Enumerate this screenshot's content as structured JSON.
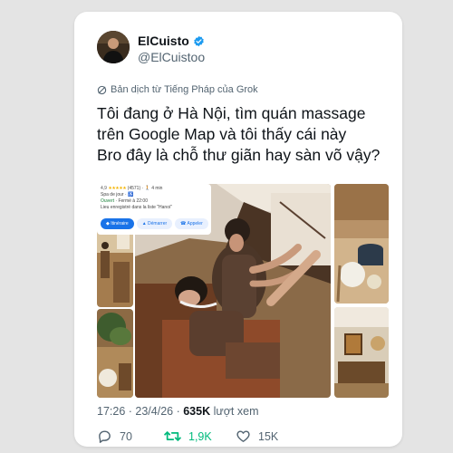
{
  "author": {
    "display_name": "ElCuisto",
    "handle": "@ElCuistoo",
    "verified": true
  },
  "translation_label": "Bản dịch từ Tiếng Pháp của Grok",
  "tweet": {
    "lines": [
      "Tôi đang ở Hà Nội, tìm quán massage",
      "trên Google Map và tôi thấy cái này",
      "Bro đây là chỗ thư giãn hay sàn võ vậy?"
    ]
  },
  "maps_card": {
    "rating": "4,9",
    "stars": "★★★★★",
    "review_count": "(4571)",
    "travel_time": "4 min",
    "category": "Spa de jour · ",
    "status": "Ouvert",
    "hours": " · Fermé à 22:00",
    "location_note": "Lieu enregistré dans la liste \"Hanoi\"",
    "buttons": [
      "Itinéraire",
      "Démarrer",
      "Appeler"
    ]
  },
  "meta": {
    "time": "17:26",
    "date": "23/4/26",
    "views_count": "635K",
    "views_label": "lượt xem"
  },
  "stats": {
    "replies": "70",
    "reposts": "1,9K",
    "likes": "15K"
  },
  "colors": {
    "verified": "#1d9bf0",
    "repost_active": "#00ba7c",
    "text_primary": "#0f1419",
    "text_secondary": "#536471"
  }
}
